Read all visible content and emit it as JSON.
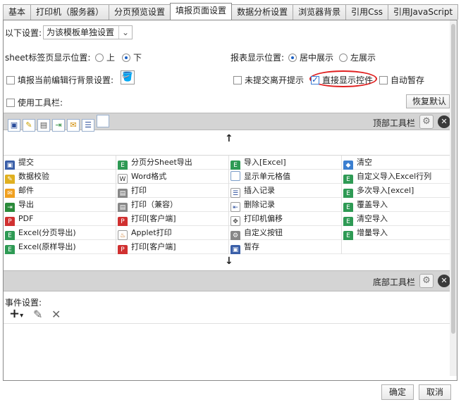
{
  "tabs": [
    {
      "label": "基本",
      "active": false
    },
    {
      "label": "打印机（服务器）",
      "active": false
    },
    {
      "label": "分页预览设置",
      "active": false
    },
    {
      "label": "填报页面设置",
      "active": true
    },
    {
      "label": "数据分析设置",
      "active": false
    },
    {
      "label": "浏览器背景",
      "active": false
    },
    {
      "label": "引用Css",
      "active": false
    },
    {
      "label": "引用JavaScript",
      "active": false
    }
  ],
  "settings": {
    "scope_label": "以下设置:",
    "scope_value": "为该模板单独设置",
    "sheet_tab_label": "sheet标签页显示位置:",
    "sheet_tab_top": "上",
    "sheet_tab_bottom": "下",
    "report_pos_label": "报表显示位置:",
    "report_pos_center": "居中展示",
    "report_pos_left": "左展示",
    "bg_label": "填报当前编辑行背景设置:",
    "unsubmitted_label": "未提交离开提示",
    "direct_show_label": "直接显示控件",
    "autosave_label": "自动暂存",
    "use_toolbar_label": "使用工具栏:",
    "restore_default": "恢复默认"
  },
  "toolbar": {
    "top_label": "顶部工具栏",
    "bottom_label": "底部工具栏",
    "up_arrow": "↑",
    "down_arrow": "↓"
  },
  "grid": [
    [
      "提交",
      "分页分Sheet导出",
      "导入[Excel]",
      "清空"
    ],
    [
      "数据校验",
      "Word格式",
      "显示单元格值",
      "自定义导入Excel行列"
    ],
    [
      "邮件",
      "打印",
      "插入记录",
      "多次导入[excel]"
    ],
    [
      "导出",
      "打印（兼容）",
      "删除记录",
      "覆盖导入"
    ],
    [
      "PDF",
      "打印[客户端]",
      "打印机偏移",
      "清空导入"
    ],
    [
      "Excel(分页导出)",
      "Applet打印",
      "自定义按钮",
      "增量导入"
    ],
    [
      "Excel(原样导出)",
      "打印[客户端]",
      "暂存",
      ""
    ]
  ],
  "events": {
    "label": "事件设置:",
    "add": "+",
    "dropdown": "▾",
    "edit": "✎",
    "delete": "✕"
  },
  "footer": {
    "ok": "确定",
    "cancel": "取消"
  },
  "colors": {
    "accent": "#1a5fc4",
    "highlight_ring": "#e02020"
  }
}
